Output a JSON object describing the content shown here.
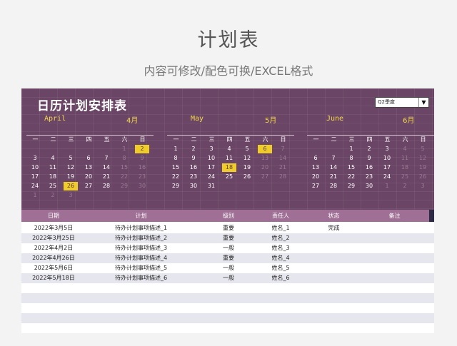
{
  "page": {
    "title": "计划表",
    "subtitle": "内容可修改/配色可换/EXCEL格式"
  },
  "calendar": {
    "title": "日历计划安排表",
    "quarter": "Q2季度",
    "weekdays": [
      "一",
      "二",
      "三",
      "四",
      "五",
      "六",
      "日"
    ],
    "months": [
      {
        "name": "April",
        "num": "4月",
        "offset": 5,
        "days": 30,
        "after": 3,
        "highlight": [
          2,
          26
        ]
      },
      {
        "name": "May",
        "num": "5月",
        "offset": 0,
        "days": 31,
        "after": 0,
        "highlight": [
          6,
          18
        ]
      },
      {
        "name": "June",
        "num": "6月",
        "offset": 2,
        "days": 30,
        "after": 3,
        "highlight": []
      }
    ]
  },
  "table": {
    "headers": [
      "日期",
      "计划",
      "级别",
      "责任人",
      "状态",
      "备注"
    ],
    "rows": [
      {
        "date": "2022年3月5日",
        "plan": "待办计划事项描述_1",
        "level": "重要",
        "owner": "姓名_1",
        "status": "完成",
        "note": ""
      },
      {
        "date": "2022年3月25日",
        "plan": "待办计划事项描述_2",
        "level": "重要",
        "owner": "姓名_2",
        "status": "",
        "note": ""
      },
      {
        "date": "2022年4月2日",
        "plan": "待办计划事项描述_3",
        "level": "一般",
        "owner": "姓名_3",
        "status": "",
        "note": ""
      },
      {
        "date": "2022年4月26日",
        "plan": "待办计划事项描述_4",
        "level": "重要",
        "owner": "姓名_4",
        "status": "",
        "note": ""
      },
      {
        "date": "2022年5月6日",
        "plan": "待办计划事项描述_5",
        "level": "一般",
        "owner": "姓名_5",
        "status": "",
        "note": ""
      },
      {
        "date": "2022年5月18日",
        "plan": "待办计划事项描述_6",
        "level": "一般",
        "owner": "姓名_6",
        "status": "",
        "note": ""
      },
      {
        "date": "",
        "plan": "",
        "level": "",
        "owner": "",
        "status": "",
        "note": ""
      },
      {
        "date": "",
        "plan": "",
        "level": "",
        "owner": "",
        "status": "",
        "note": ""
      },
      {
        "date": "",
        "plan": "",
        "level": "",
        "owner": "",
        "status": "",
        "note": ""
      },
      {
        "date": "",
        "plan": "",
        "level": "",
        "owner": "",
        "status": "",
        "note": ""
      },
      {
        "date": "",
        "plan": "",
        "level": "",
        "owner": "",
        "status": "",
        "note": ""
      }
    ]
  },
  "colors": {
    "panel": "#6b4566",
    "header": "#9f6f96",
    "highlight": "#f0cc28",
    "accent_text": "#f2d94a"
  }
}
